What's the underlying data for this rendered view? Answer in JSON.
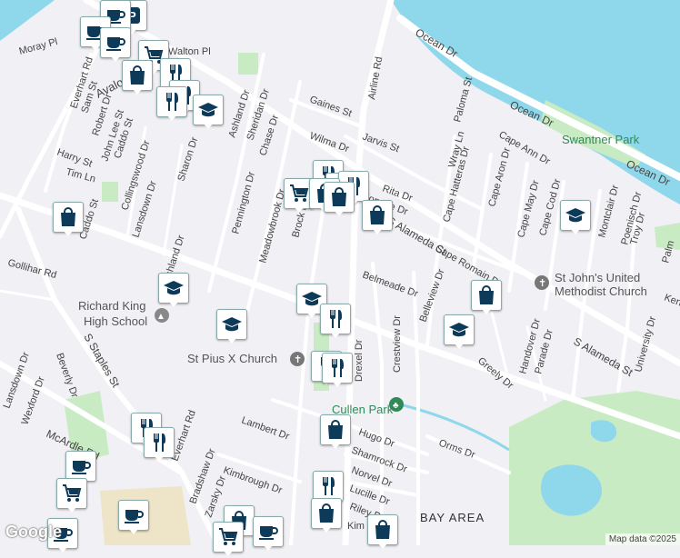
{
  "map": {
    "attribution": "Map data ©2025",
    "logo": "Google",
    "colors": {
      "water": "#8fd8ec",
      "park": "#c9ebc4",
      "road": "#ffffff",
      "land": "#f1f0f4",
      "marker": "#0e3a5a"
    }
  },
  "streets": [
    "Moray Pl",
    "Walton Pl",
    "Everhart Rd",
    "Avalon",
    "Sam St",
    "Robert Dr",
    "John Lee St",
    "Caddo St",
    "Harry St",
    "Tim Ln",
    "Collingswood Dr",
    "Lansdown Dr",
    "Sharon Dr",
    "Ashland Dr",
    "Sheridan Dr",
    "Chase Dr",
    "Gaines St",
    "Wilma Dr",
    "Jarvis St",
    "Airline Rd",
    "Ocean Dr",
    "Paloma St",
    "Cape Ann Dr",
    "Wray Ln",
    "Cape Aron Dr",
    "Cape Hatteras Dr",
    "Cape May Dr",
    "Cape Cod Dr",
    "Montclair Dr",
    "Poenisch Dr",
    "Troy Dr",
    "Rita Dr",
    "Monette Dr",
    "Meadowbrook Dr",
    "Brock Dr",
    "S Alameda St",
    "Cape Romain Dr",
    "Belmeade Dr",
    "Belleview Dr",
    "Kenwood Dr",
    "Gollihar Rd",
    "Crestview Dr",
    "Handover Dr",
    "Parade Dr",
    "Greely Dr",
    "University Dr",
    "Drexel Dr",
    "Pennington Dr",
    "S Staples St",
    "Beverly Dr",
    "Lansdown Dr",
    "Wexford Dr",
    "McArdle Rd",
    "Lambert Dr",
    "Bradshaw Dr",
    "Kimbrough Dr",
    "Zarsky Dr",
    "Hugo Dr",
    "Shamrock Dr",
    "Norvel Dr",
    "Lucille Dr",
    "Riley Dr",
    "Orms Dr",
    "Kim Dr",
    "Cullen Park",
    "Palm"
  ],
  "places": {
    "park": "Swantner Park",
    "church1": "St John's United Methodist Church",
    "school": "Richard King High School",
    "church2": "St Pius X Church",
    "park2": "Cullen Park",
    "area": "BAY AREA"
  }
}
